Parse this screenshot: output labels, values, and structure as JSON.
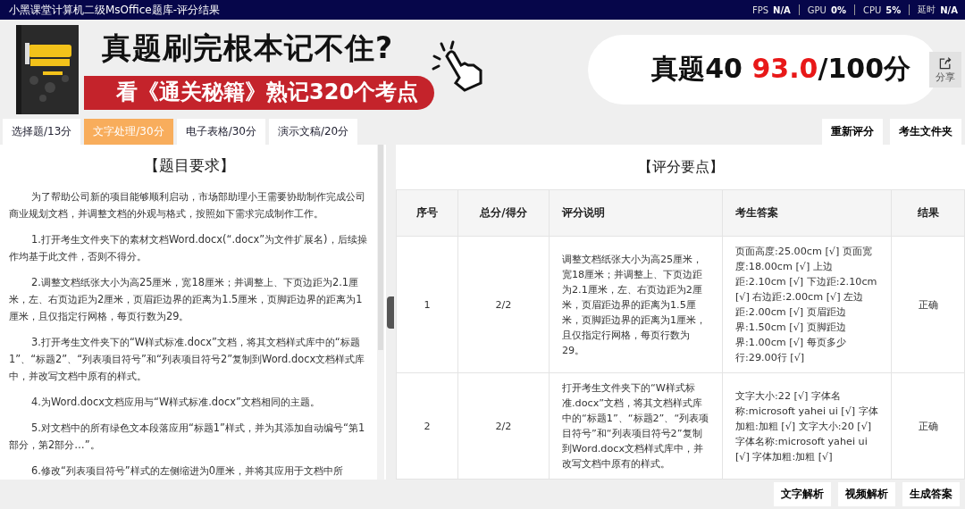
{
  "window": {
    "title": "小黑课堂计算机二级MsOffice题库-评分结果"
  },
  "stats": [
    {
      "label": "FPS",
      "value": "N/A"
    },
    {
      "label": "GPU",
      "value": "0%"
    },
    {
      "label": "CPU",
      "value": "5%"
    },
    {
      "label": "延时",
      "value": "N/A"
    }
  ],
  "banner": {
    "headline": "真题刷完根本记不住?",
    "tagline": "看《通关秘籍》熟记320个考点"
  },
  "score": {
    "prefix": "真题40",
    "value": "93.0",
    "suffix": "/100分"
  },
  "share": {
    "label": "分享"
  },
  "tabs": [
    {
      "label": "选择题/13分",
      "selected": false
    },
    {
      "label": "文字处理/30分",
      "selected": true
    },
    {
      "label": "电子表格/30分",
      "selected": false
    },
    {
      "label": "演示文稿/20分",
      "selected": false
    }
  ],
  "actions": [
    "重新评分",
    "考生文件夹"
  ],
  "requirements": {
    "title": "【题目要求】",
    "paragraphs": [
      "为了帮助公司新的项目能够顺利启动，市场部助理小王需要协助制作完成公司商业规划文档，并调整文档的外观与格式，按照如下需求完成制作工作。",
      "1.打开考生文件夹下的素材文档Word.docx(“.docx”为文件扩展名)，后续操作均基于此文件，否则不得分。",
      "2.调整文档纸张大小为高25厘米，宽18厘米；并调整上、下页边距为2.1厘米，左、右页边距为2厘米，页眉距边界的距离为1.5厘米，页脚距边界的距离为1厘米，且仅指定行网格，每页行数为29。",
      "3.打开考生文件夹下的“W样式标准.docx”文档，将其文档样式库中的“标题1”、“标题2”、“列表项目符号”和“列表项目符号2”复制到Word.docx文档样式库中，并改写文档中原有的样式。",
      "4.为Word.docx文档应用与“W样式标准.docx”文档相同的主题。",
      "5.对文档中的所有绿色文本段落应用“标题1”样式，并为其添加自动编号“第1部分，第2部分…”。",
      "6.修改“列表项目符号”样式的左侧缩进为0厘米，并将其应用于文档中所"
    ]
  },
  "grading": {
    "title": "【评分要点】",
    "columns": [
      "序号",
      "总分/得分",
      "评分说明",
      "考生答案",
      "结果"
    ],
    "rows": [
      [
        "1",
        "2/2",
        "调整文档纸张大小为高25厘米，宽18厘米；并调整上、下页边距为2.1厘米，左、右页边距为2厘米，页眉距边界的距离为1.5厘米，页脚距边界的距离为1厘米，且仅指定行网格，每页行数为29。",
        "页面高度:25.00cm [√] 页面宽度:18.00cm [√] 上边距:2.10cm [√] 下边距:2.10cm [√] 右边距:2.00cm [√] 左边距:2.00cm [√] 页眉距边界:1.50cm [√] 页脚距边界:1.00cm [√] 每页多少行:29.00行 [√]",
        "正确"
      ],
      [
        "2",
        "2/2",
        "打开考生文件夹下的“W样式标准.docx”文档，将其文档样式库中的“标题1”、“标题2”、“列表项目符号”和“列表项目符号2”复制到Word.docx文档样式库中，并改写文档中原有的样式。",
        "文字大小:22 [√] 字体名称:microsoft yahei ui [√] 字体加粗:加粗 [√] 文字大小:20 [√] 字体名称:microsoft yahei ui [√] 字体加粗:加粗 [√]",
        "正确"
      ]
    ]
  },
  "footer_buttons": [
    "文字解析",
    "视频解析",
    "生成答案"
  ]
}
